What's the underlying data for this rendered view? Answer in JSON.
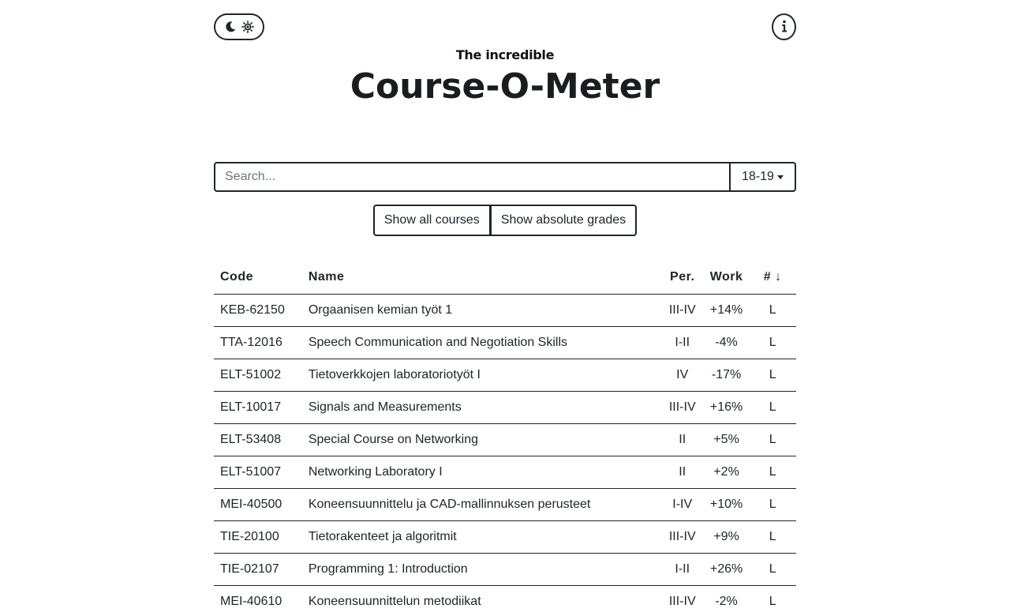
{
  "header": {
    "subtitle": "The incredible",
    "title": "Course-O-Meter",
    "theme_toggle_icons": [
      "moon-icon",
      "sun-icon"
    ],
    "info_icon": "info-icon"
  },
  "search": {
    "placeholder": "Search...",
    "value": "",
    "year_selected": "18-19"
  },
  "toolbar": {
    "show_all_courses_label": "Show all courses",
    "show_absolute_grades_label": "Show absolute grades"
  },
  "table": {
    "headers": {
      "code": "Code",
      "name": "Name",
      "period": "Per.",
      "work": "Work",
      "count": "#",
      "count_sort": "↓"
    },
    "rows": [
      {
        "code": "KEB-62150",
        "name": "Orgaanisen kemian työt 1",
        "period": "III-IV",
        "work": "+14%",
        "count": "L"
      },
      {
        "code": "TTA-12016",
        "name": "Speech Communication and Negotiation Skills",
        "period": "I-II",
        "work": "-4%",
        "count": "L"
      },
      {
        "code": "ELT-51002",
        "name": "Tietoverkkojen laboratoriotyöt I",
        "period": "IV",
        "work": "-17%",
        "count": "L"
      },
      {
        "code": "ELT-10017",
        "name": "Signals and Measurements",
        "period": "III-IV",
        "work": "+16%",
        "count": "L"
      },
      {
        "code": "ELT-53408",
        "name": "Special Course on Networking",
        "period": "II",
        "work": "+5%",
        "count": "L"
      },
      {
        "code": "ELT-51007",
        "name": "Networking Laboratory I",
        "period": "II",
        "work": "+2%",
        "count": "L"
      },
      {
        "code": "MEI-40500",
        "name": "Koneensuunnittelu ja CAD-mallinnuksen perusteet",
        "period": "I-IV",
        "work": "+10%",
        "count": "L"
      },
      {
        "code": "TIE-20100",
        "name": "Tietorakenteet ja algoritmit",
        "period": "III-IV",
        "work": "+9%",
        "count": "L"
      },
      {
        "code": "TIE-02107",
        "name": "Programming 1: Introduction",
        "period": "I-II",
        "work": "+26%",
        "count": "L"
      },
      {
        "code": "MEI-40610",
        "name": "Koneensuunnittelun metodiikat",
        "period": "III-IV",
        "work": "-2%",
        "count": "L"
      }
    ]
  }
}
